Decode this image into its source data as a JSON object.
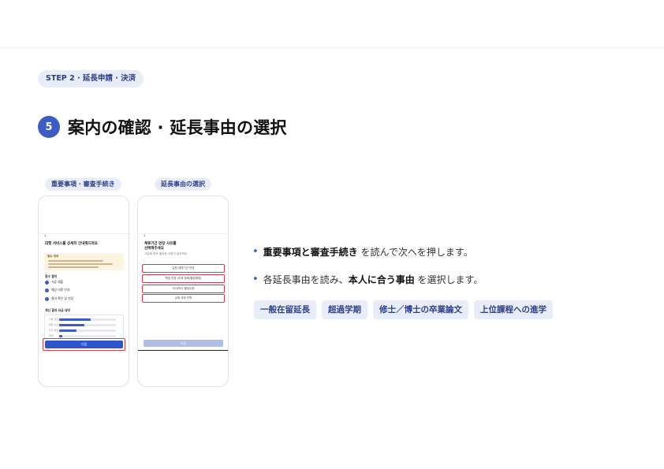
{
  "step_label": "STEP 2 · 延長申請 · 決済",
  "section": {
    "number": "5",
    "title": "案内の確認 · 延長事由の選択"
  },
  "phones": [
    {
      "label": "重要事項 · 審査手続き",
      "back": "‹",
      "title": "대행 서비스를 상세히 안내해드려요",
      "note_title": "필요 정보",
      "sections": [
        "접수 절차"
      ],
      "radios": [
        "서류 제출",
        "예상 비용 안내",
        "결과 확인 및 연장"
      ],
      "summary_title": "계산 결과 요금 내역",
      "bars": [
        {
          "label": "기본 요금",
          "fraction": 0.55
        },
        {
          "label": "대행 수수료",
          "fraction": 0.45
        },
        {
          "label": "추가 비용",
          "fraction": 0.3
        },
        {
          "label": "합계",
          "fraction": 0.05
        }
      ],
      "button": "다음"
    },
    {
      "label": "延長事由の選択",
      "back": "‹",
      "title": "체류기간 연장 사유를",
      "title2": "선택해주세요",
      "sub": "사유에 따라 필요한 서류가 달라져요",
      "options": [
        "일반 체류기간 연장",
        "학업 연장 (초과 등록/졸업예정)",
        "석사/박사 졸업논문",
        "상위 과정 진학"
      ],
      "button": "다음"
    }
  ],
  "bullets": [
    {
      "bold": "重要事項と審査手続き",
      "rest": " を読んで次へを押します。"
    },
    {
      "pre": "各延長事由を読み、",
      "bold": "本人に合う事由",
      "rest": " を選択します。"
    }
  ],
  "chips": [
    "一般在留延長",
    "超過学期",
    "修士／博士の卒業論文",
    "上位課程への進学"
  ],
  "colors": {
    "accent": "#3d5cc4",
    "highlight": "#d33a4b",
    "pill_bg": "#e8edf9"
  }
}
